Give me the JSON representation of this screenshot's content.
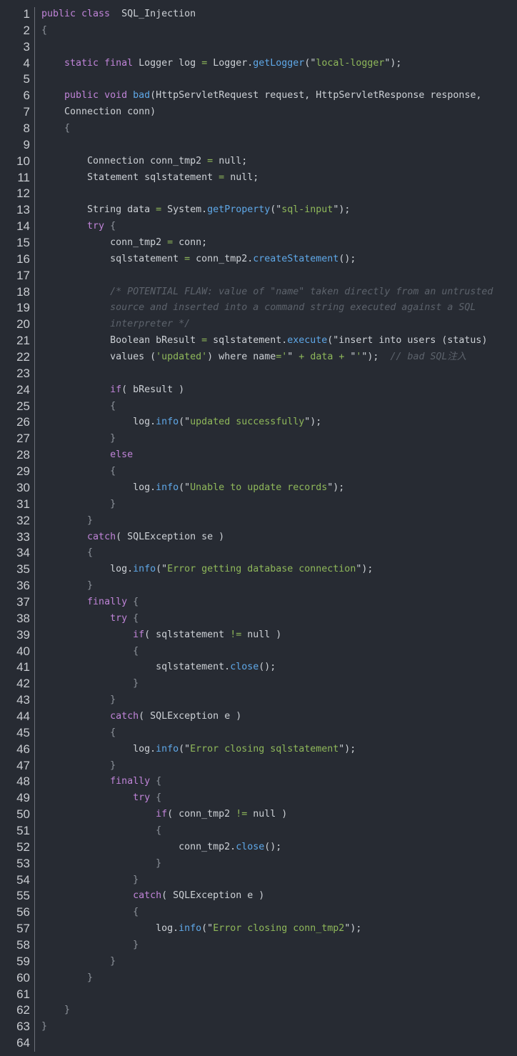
{
  "colors": {
    "background": "#272b33",
    "keyword": "#c084d8",
    "function": "#5fa8e8",
    "string": "#8fb85a",
    "comment": "#5d636c",
    "text": "#cdd1d6"
  },
  "code_lines": [
    [
      [
        "k",
        "public class"
      ],
      [
        "",
        "  SQL_Injection"
      ]
    ],
    [
      [
        "p",
        "{"
      ]
    ],
    [],
    [
      [
        "",
        "    "
      ],
      [
        "k",
        "static final"
      ],
      [
        "",
        " Logger log "
      ],
      [
        "o",
        "="
      ],
      [
        "",
        " Logger."
      ],
      [
        "f",
        "getLogger"
      ],
      [
        "",
        "(\""
      ],
      [
        "s",
        "local-logger"
      ],
      [
        "",
        "\");"
      ]
    ],
    [],
    [
      [
        "",
        "    "
      ],
      [
        "k",
        "public void"
      ],
      [
        "",
        " "
      ],
      [
        "f",
        "bad"
      ],
      [
        "",
        "(HttpServletRequest request, HttpServletResponse response,"
      ]
    ],
    [
      [
        "",
        "    Connection conn)"
      ]
    ],
    [
      [
        "",
        "    "
      ],
      [
        "p",
        "{"
      ]
    ],
    [],
    [
      [
        "",
        "        Connection conn_tmp2 "
      ],
      [
        "o",
        "="
      ],
      [
        "",
        " null;"
      ]
    ],
    [
      [
        "",
        "        Statement sqlstatement "
      ],
      [
        "o",
        "="
      ],
      [
        "",
        " null;"
      ]
    ],
    [],
    [
      [
        "",
        "        String data "
      ],
      [
        "o",
        "="
      ],
      [
        "",
        " System."
      ],
      [
        "f",
        "getProperty"
      ],
      [
        "",
        "(\""
      ],
      [
        "s",
        "sql-input"
      ],
      [
        "",
        "\");"
      ]
    ],
    [
      [
        "",
        "        "
      ],
      [
        "k",
        "try"
      ],
      [
        "",
        " "
      ],
      [
        "p",
        "{"
      ]
    ],
    [
      [
        "",
        "            conn_tmp2 "
      ],
      [
        "o",
        "="
      ],
      [
        "",
        " conn;"
      ]
    ],
    [
      [
        "",
        "            sqlstatement "
      ],
      [
        "o",
        "="
      ],
      [
        "",
        " conn_tmp2."
      ],
      [
        "f",
        "createStatement"
      ],
      [
        "",
        "();"
      ]
    ],
    [],
    [
      [
        "",
        "            "
      ],
      [
        "c",
        "/* POTENTIAL FLAW: value of \"name\" taken directly from an untrusted"
      ]
    ],
    [
      [
        "",
        "            "
      ],
      [
        "c",
        "source and inserted into a command string executed against a SQL"
      ]
    ],
    [
      [
        "",
        "            "
      ],
      [
        "c",
        "interpreter */"
      ]
    ],
    [
      [
        "",
        "            Boolean bResult "
      ],
      [
        "o",
        "="
      ],
      [
        "",
        " sqlstatement."
      ],
      [
        "f",
        "execute"
      ],
      [
        "",
        "(\"insert into users (status)"
      ]
    ],
    [
      [
        "",
        "            values ("
      ],
      [
        "s",
        "'updated'"
      ],
      [
        "",
        ") where name"
      ],
      [
        "o",
        "="
      ],
      [
        "s",
        "'"
      ],
      [
        "",
        "\" "
      ],
      [
        "o",
        "+"
      ],
      [
        "s",
        " data "
      ],
      [
        "o",
        "+"
      ],
      [
        "",
        " \""
      ],
      [
        "s",
        "'"
      ],
      [
        "",
        "\");  "
      ],
      [
        "c",
        "// bad SQL注入"
      ]
    ],
    [],
    [
      [
        "",
        "            "
      ],
      [
        "k",
        "if"
      ],
      [
        "",
        "( bResult )"
      ]
    ],
    [
      [
        "",
        "            "
      ],
      [
        "p",
        "{"
      ]
    ],
    [
      [
        "",
        "                log."
      ],
      [
        "f",
        "info"
      ],
      [
        "",
        "(\""
      ],
      [
        "s",
        "updated successfully"
      ],
      [
        "",
        "\");"
      ]
    ],
    [
      [
        "",
        "            "
      ],
      [
        "p",
        "}"
      ]
    ],
    [
      [
        "",
        "            "
      ],
      [
        "k",
        "else"
      ]
    ],
    [
      [
        "",
        "            "
      ],
      [
        "p",
        "{"
      ]
    ],
    [
      [
        "",
        "                log."
      ],
      [
        "f",
        "info"
      ],
      [
        "",
        "(\""
      ],
      [
        "s",
        "Unable to update records"
      ],
      [
        "",
        "\");"
      ]
    ],
    [
      [
        "",
        "            "
      ],
      [
        "p",
        "}"
      ]
    ],
    [
      [
        "",
        "        "
      ],
      [
        "p",
        "}"
      ]
    ],
    [
      [
        "",
        "        "
      ],
      [
        "k",
        "catch"
      ],
      [
        "",
        "( SQLException se )"
      ]
    ],
    [
      [
        "",
        "        "
      ],
      [
        "p",
        "{"
      ]
    ],
    [
      [
        "",
        "            log."
      ],
      [
        "f",
        "info"
      ],
      [
        "",
        "(\""
      ],
      [
        "s",
        "Error getting database connection"
      ],
      [
        "",
        "\");"
      ]
    ],
    [
      [
        "",
        "        "
      ],
      [
        "p",
        "}"
      ]
    ],
    [
      [
        "",
        "        "
      ],
      [
        "k",
        "finally"
      ],
      [
        "",
        " "
      ],
      [
        "p",
        "{"
      ]
    ],
    [
      [
        "",
        "            "
      ],
      [
        "k",
        "try"
      ],
      [
        "",
        " "
      ],
      [
        "p",
        "{"
      ]
    ],
    [
      [
        "",
        "                "
      ],
      [
        "k",
        "if"
      ],
      [
        "",
        "( sqlstatement "
      ],
      [
        "o",
        "!="
      ],
      [
        "",
        " null )"
      ]
    ],
    [
      [
        "",
        "                "
      ],
      [
        "p",
        "{"
      ]
    ],
    [
      [
        "",
        "                    sqlstatement."
      ],
      [
        "f",
        "close"
      ],
      [
        "",
        "();"
      ]
    ],
    [
      [
        "",
        "                "
      ],
      [
        "p",
        "}"
      ]
    ],
    [
      [
        "",
        "            "
      ],
      [
        "p",
        "}"
      ]
    ],
    [
      [
        "",
        "            "
      ],
      [
        "k",
        "catch"
      ],
      [
        "",
        "( SQLException e )"
      ]
    ],
    [
      [
        "",
        "            "
      ],
      [
        "p",
        "{"
      ]
    ],
    [
      [
        "",
        "                log."
      ],
      [
        "f",
        "info"
      ],
      [
        "",
        "(\""
      ],
      [
        "s",
        "Error closing sqlstatement"
      ],
      [
        "",
        "\");"
      ]
    ],
    [
      [
        "",
        "            "
      ],
      [
        "p",
        "}"
      ]
    ],
    [
      [
        "",
        "            "
      ],
      [
        "k",
        "finally"
      ],
      [
        "",
        " "
      ],
      [
        "p",
        "{"
      ]
    ],
    [
      [
        "",
        "                "
      ],
      [
        "k",
        "try"
      ],
      [
        "",
        " "
      ],
      [
        "p",
        "{"
      ]
    ],
    [
      [
        "",
        "                    "
      ],
      [
        "k",
        "if"
      ],
      [
        "",
        "( conn_tmp2 "
      ],
      [
        "o",
        "!="
      ],
      [
        "",
        " null )"
      ]
    ],
    [
      [
        "",
        "                    "
      ],
      [
        "p",
        "{"
      ]
    ],
    [
      [
        "",
        "                        conn_tmp2."
      ],
      [
        "f",
        "close"
      ],
      [
        "",
        "();"
      ]
    ],
    [
      [
        "",
        "                    "
      ],
      [
        "p",
        "}"
      ]
    ],
    [
      [
        "",
        "                "
      ],
      [
        "p",
        "}"
      ]
    ],
    [
      [
        "",
        "                "
      ],
      [
        "k",
        "catch"
      ],
      [
        "",
        "( SQLException e )"
      ]
    ],
    [
      [
        "",
        "                "
      ],
      [
        "p",
        "{"
      ]
    ],
    [
      [
        "",
        "                    log."
      ],
      [
        "f",
        "info"
      ],
      [
        "",
        "(\""
      ],
      [
        "s",
        "Error closing conn_tmp2"
      ],
      [
        "",
        "\");"
      ]
    ],
    [
      [
        "",
        "                "
      ],
      [
        "p",
        "}"
      ]
    ],
    [
      [
        "",
        "            "
      ],
      [
        "p",
        "}"
      ]
    ],
    [
      [
        "",
        "        "
      ],
      [
        "p",
        "}"
      ]
    ],
    [],
    [
      [
        "",
        "    "
      ],
      [
        "p",
        "}"
      ]
    ],
    [
      [
        "p",
        "}"
      ]
    ],
    []
  ]
}
